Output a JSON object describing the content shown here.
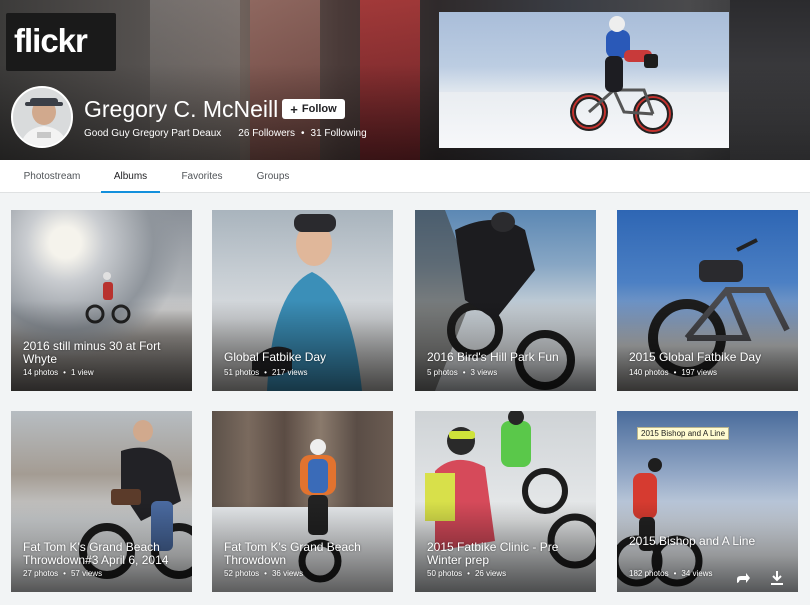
{
  "brand": {
    "logo_text": "flickr"
  },
  "profile": {
    "name": "Gregory C. McNeill",
    "follow_label": "Follow",
    "tagline": "Good Guy Gregory Part Deaux",
    "followers": "26 Followers",
    "following": "31 Following"
  },
  "tabs": [
    {
      "label": "Photostream"
    },
    {
      "label": "Albums"
    },
    {
      "label": "Favorites"
    },
    {
      "label": "Groups"
    }
  ],
  "active_tab": "Albums",
  "albums": [
    {
      "title": "2016 still minus 30 at Fort Whyte",
      "photos": "14 photos",
      "views": "1 view"
    },
    {
      "title": "Global Fatbike Day",
      "photos": "51 photos",
      "views": "217 views"
    },
    {
      "title": "2016 Bird's Hill Park Fun",
      "photos": "5 photos",
      "views": "3 views"
    },
    {
      "title": "2015 Global Fatbike Day",
      "photos": "140 photos",
      "views": "197 views"
    },
    {
      "title": "Fat Tom K's Grand Beach Throwdown#3 April 6, 2014",
      "photos": "27 photos",
      "views": "57 views"
    },
    {
      "title": "Fat Tom K's Grand Beach Throwdown",
      "photos": "52 photos",
      "views": "36 views"
    },
    {
      "title": "2015 Fatbike Clinic - Pre Winter prep",
      "photos": "50 photos",
      "views": "26 views"
    },
    {
      "title": "2015 Bishop and A Line",
      "photos": "182 photos",
      "views": "34 views",
      "tooltip": "2015 Bishop and A Line"
    }
  ],
  "icons": {
    "share": "share-icon",
    "download": "download-icon",
    "plus": "plus-icon"
  },
  "colors": {
    "accent": "#128fdc",
    "page_bg": "#f2f4f5"
  }
}
